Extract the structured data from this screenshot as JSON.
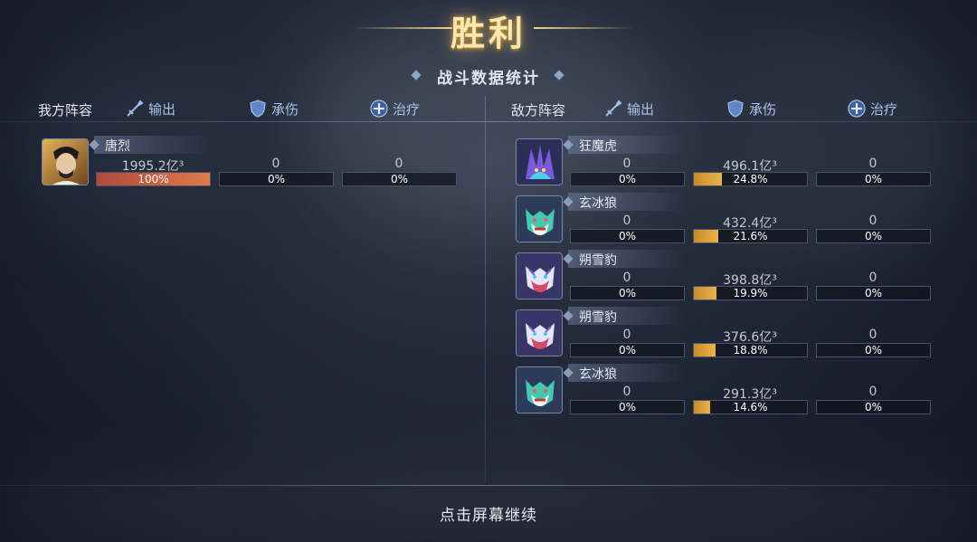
{
  "title": "胜利",
  "subtitle": "战斗数据统计",
  "columns": {
    "output": "输出",
    "damage_taken": "承伤",
    "heal": "治疗"
  },
  "ally": {
    "label": "我方阵容",
    "members": [
      {
        "name": "唐烈",
        "output": "1995.2亿³",
        "output_pct": "100%",
        "output_frac": 1.0,
        "damage": "0",
        "damage_pct": "0%",
        "damage_frac": 0,
        "heal": "0",
        "heal_pct": "0%",
        "heal_frac": 0
      }
    ]
  },
  "enemy": {
    "label": "敌方阵容",
    "members": [
      {
        "name": "狂魔虎",
        "output": "0",
        "output_pct": "0%",
        "output_frac": 0,
        "damage": "496.1亿³",
        "damage_pct": "24.8%",
        "damage_frac": 0.248,
        "heal": "0",
        "heal_pct": "0%",
        "heal_frac": 0
      },
      {
        "name": "玄冰狼",
        "output": "0",
        "output_pct": "0%",
        "output_frac": 0,
        "damage": "432.4亿³",
        "damage_pct": "21.6%",
        "damage_frac": 0.216,
        "heal": "0",
        "heal_pct": "0%",
        "heal_frac": 0
      },
      {
        "name": "朔雪豹",
        "output": "0",
        "output_pct": "0%",
        "output_frac": 0,
        "damage": "398.8亿³",
        "damage_pct": "19.9%",
        "damage_frac": 0.199,
        "heal": "0",
        "heal_pct": "0%",
        "heal_frac": 0
      },
      {
        "name": "朔雪豹",
        "output": "0",
        "output_pct": "0%",
        "output_frac": 0,
        "damage": "376.6亿³",
        "damage_pct": "18.8%",
        "damage_frac": 0.188,
        "heal": "0",
        "heal_pct": "0%",
        "heal_frac": 0
      },
      {
        "name": "玄冰狼",
        "output": "0",
        "output_pct": "0%",
        "output_frac": 0,
        "damage": "291.3亿³",
        "damage_pct": "14.6%",
        "damage_frac": 0.146,
        "heal": "0",
        "heal_pct": "0%",
        "heal_frac": 0
      }
    ]
  },
  "footer": {
    "continue": "点击屏幕继续"
  },
  "colors": {
    "gold_fill": "#e8b34a",
    "red_fill": "#e07a4a",
    "accent_blue": "#a9c3ee"
  },
  "icons": {
    "output": "sword-icon",
    "damage_taken": "shield-icon",
    "heal": "heal-cross-icon"
  }
}
